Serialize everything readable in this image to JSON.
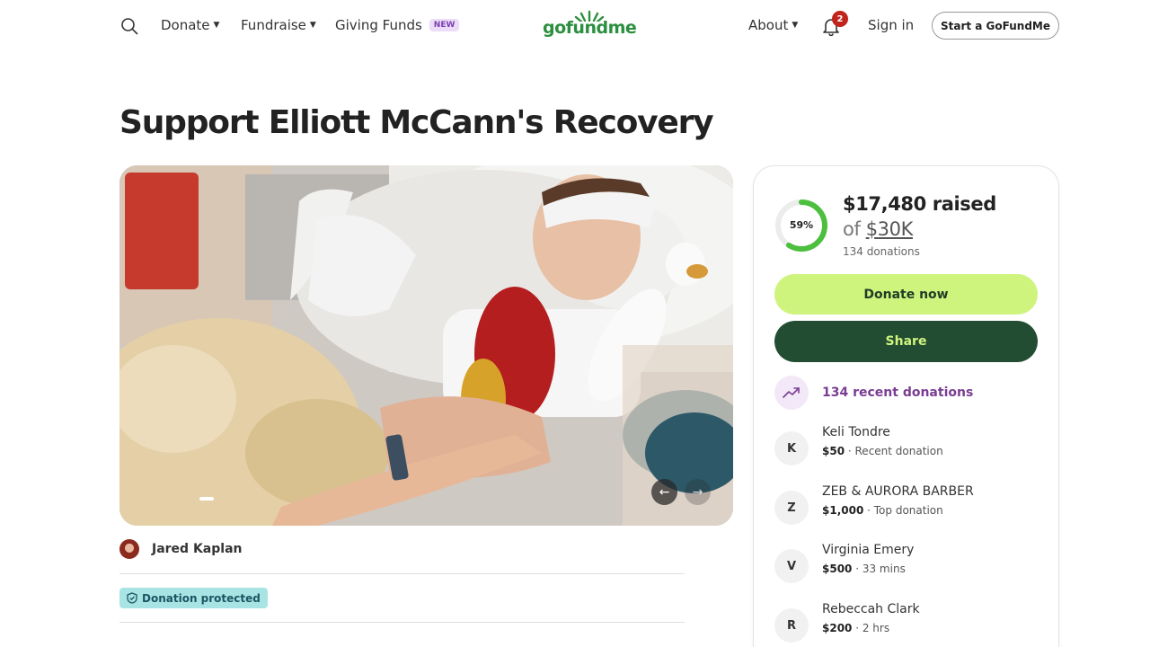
{
  "header": {
    "nav": [
      {
        "label": "Donate",
        "has_caret": true
      },
      {
        "label": "Fundraise",
        "has_caret": true
      },
      {
        "label": "Giving Funds",
        "badge": "NEW"
      }
    ],
    "logo_text": "gofundme",
    "about_label": "About",
    "notifications_count": "2",
    "signin_label": "Sign in",
    "start_label": "Start a GoFundMe"
  },
  "campaign": {
    "title": "Support Elliott McCann's Recovery",
    "organizer": "Jared Kaplan",
    "protected_label": "Donation protected",
    "carousel_prev": "←",
    "carousel_next": "→"
  },
  "progress": {
    "percent_label": "59%",
    "percent_value": 0.59,
    "raised": "$17,480 raised",
    "goal_prefix": "of ",
    "goal_amount": "$30K",
    "donations": "134 donations"
  },
  "actions": {
    "donate_label": "Donate now",
    "share_label": "Share"
  },
  "recent": {
    "label": "134 recent donations",
    "donors": [
      {
        "initial": "K",
        "name": "Keli Tondre",
        "amount": "$50",
        "note": " · Recent donation"
      },
      {
        "initial": "Z",
        "name": "ZEB & AURORA BARBER",
        "amount": "$1,000",
        "note": " · Top donation"
      },
      {
        "initial": "V",
        "name": "Virginia Emery",
        "amount": "$500",
        "note": " · 33 mins"
      },
      {
        "initial": "R",
        "name": "Rebeccah Clark",
        "amount": "$200",
        "note": " · 2 hrs"
      }
    ]
  },
  "colors": {
    "brand_green": "#2b8f3f",
    "donate_bg": "#cff47e",
    "share_bg": "#234d33",
    "recent_purple": "#7a3d93",
    "protected_bg": "#a9e4e4"
  }
}
